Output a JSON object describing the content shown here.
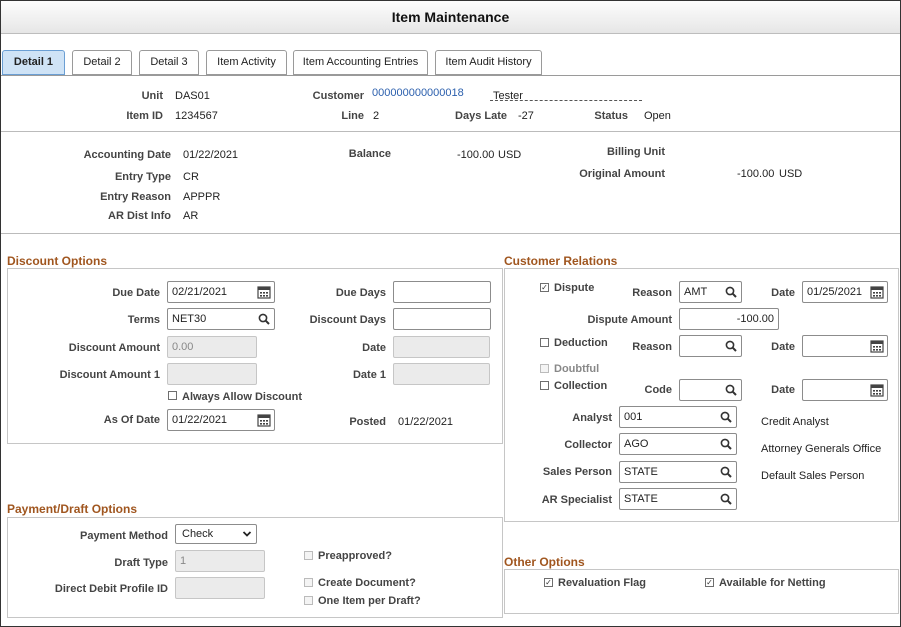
{
  "window": {
    "title": "Item Maintenance"
  },
  "tabs": [
    {
      "label": "Detail 1"
    },
    {
      "label": "Detail 2"
    },
    {
      "label": "Detail 3"
    },
    {
      "label": "Item Activity"
    },
    {
      "label": "Item Accounting Entries"
    },
    {
      "label": "Item Audit History"
    }
  ],
  "header": {
    "unit_label": "Unit",
    "unit": "DAS01",
    "customer_label": "Customer",
    "customer": "000000000000018",
    "customer_name": "Tester",
    "item_id_label": "Item ID",
    "item_id": "1234567",
    "line_label": "Line",
    "line": "2",
    "days_late_label": "Days Late",
    "days_late": "-27",
    "status_label": "Status",
    "status": "Open"
  },
  "summary": {
    "accounting_date_label": "Accounting Date",
    "accounting_date": "01/22/2021",
    "entry_type_label": "Entry Type",
    "entry_type": "CR",
    "entry_reason_label": "Entry Reason",
    "entry_reason": "APPPR",
    "ar_dist_label": "AR Dist Info",
    "ar_dist": "AR",
    "balance_label": "Balance",
    "balance": "-100.00",
    "balance_currency": "USD",
    "billing_unit_label": "Billing Unit",
    "original_amount_label": "Original Amount",
    "original_amount": "-100.00",
    "original_currency": "USD"
  },
  "discount": {
    "title": "Discount Options",
    "due_date_label": "Due Date",
    "due_date": "02/21/2021",
    "terms_label": "Terms",
    "terms": "NET30",
    "discount_amount_label": "Discount Amount",
    "discount_amount": "0.00",
    "discount_amount1_label": "Discount Amount 1",
    "always_allow_label": "Always Allow Discount",
    "as_of_date_label": "As Of Date",
    "as_of_date": "01/22/2021",
    "due_days_label": "Due Days",
    "discount_days_label": "Discount Days",
    "date_label": "Date",
    "date1_label": "Date 1",
    "posted_label": "Posted",
    "posted": "01/22/2021"
  },
  "customer_relations": {
    "title": "Customer Relations",
    "dispute_label": "Dispute",
    "reason_label": "Reason",
    "dispute_reason": "AMT",
    "date_label": "Date",
    "dispute_date": "01/25/2021",
    "dispute_amount_label": "Dispute Amount",
    "dispute_amount": "-100.00",
    "deduction_label": "Deduction",
    "doubtful_label": "Doubtful",
    "collection_label": "Collection",
    "code_label": "Code",
    "analyst_label": "Analyst",
    "analyst": "001",
    "analyst_desc": "Credit Analyst",
    "collector_label": "Collector",
    "collector": "AGO",
    "collector_desc": "Attorney Generals Office",
    "sales_person_label": "Sales Person",
    "sales_person": "STATE",
    "sales_person_desc": "Default Sales Person",
    "ar_specialist_label": "AR Specialist",
    "ar_specialist": "STATE"
  },
  "payment": {
    "title": "Payment/Draft Options",
    "method_label": "Payment Method",
    "method": "Check",
    "draft_type_label": "Draft Type",
    "draft_type": "1",
    "debit_profile_label": "Direct Debit Profile ID",
    "preapproved_label": "Preapproved?",
    "create_doc_label": "Create Document?",
    "one_item_label": "One Item per Draft?"
  },
  "other": {
    "title": "Other Options",
    "revaluation_label": "Revaluation Flag",
    "netting_label": "Available for Netting"
  },
  "icons": {
    "lookup": "magnifier-icon",
    "calendar": "calendar-icon",
    "dropdown": "chevron-down-icon"
  }
}
